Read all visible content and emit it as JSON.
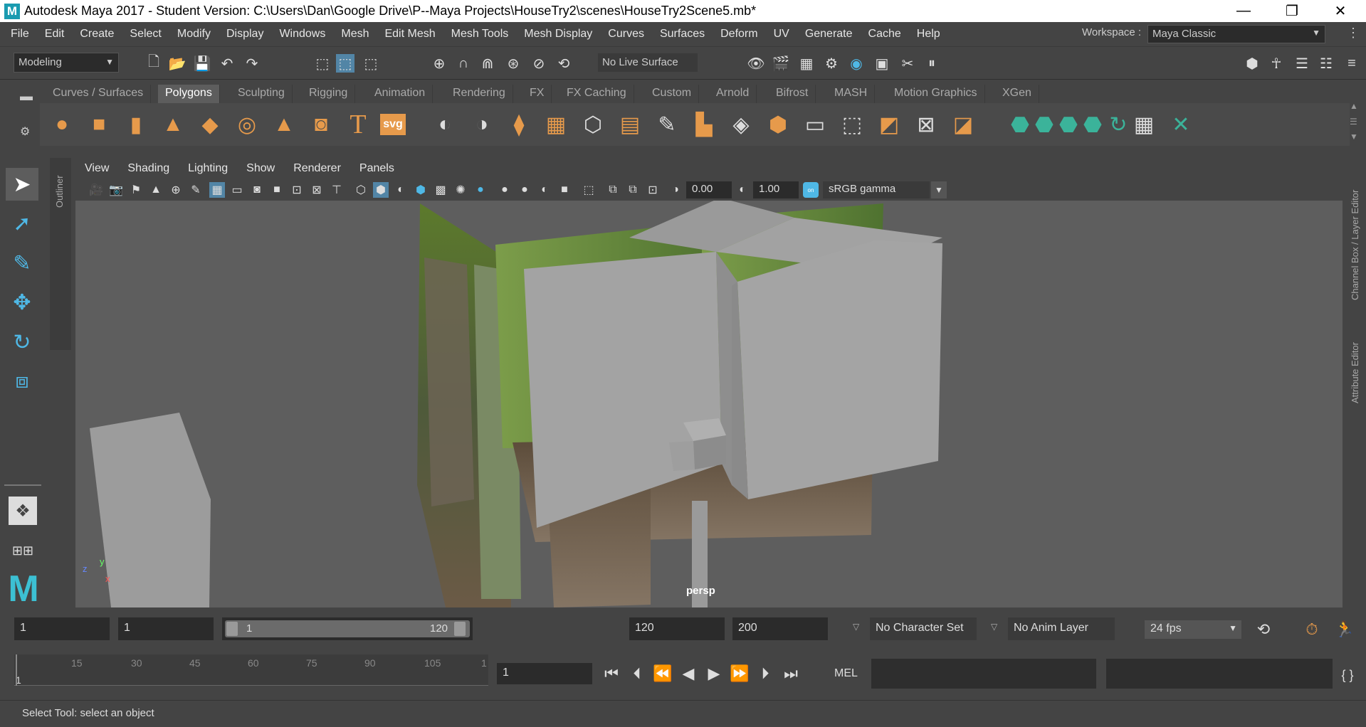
{
  "window": {
    "title": "Autodesk Maya 2017 - Student Version: C:\\Users\\Dan\\Google Drive\\P--Maya Projects\\HouseTry2\\scenes\\HouseTry2Scene5.mb*",
    "logo_letter": "M",
    "min": "—",
    "max": "❐",
    "close": "✕"
  },
  "menu": [
    "File",
    "Edit",
    "Create",
    "Select",
    "Modify",
    "Display",
    "Windows",
    "Mesh",
    "Edit Mesh",
    "Mesh Tools",
    "Mesh Display",
    "Curves",
    "Surfaces",
    "Deform",
    "UV",
    "Generate",
    "Cache",
    "Help"
  ],
  "workspace": {
    "label": "Workspace :",
    "value": "Maya Classic"
  },
  "status": {
    "menuset": "Modeling",
    "live_surface": "No Live Surface"
  },
  "shelf_tabs": [
    "Curves / Surfaces",
    "Polygons",
    "Sculpting",
    "Rigging",
    "Animation",
    "Rendering",
    "FX",
    "FX Caching",
    "Custom",
    "Arnold",
    "Bifrost",
    "MASH",
    "Motion Graphics",
    "XGen"
  ],
  "shelf_active": "Polygons",
  "shelf_text_icons": {
    "text": "T",
    "svg": "svg"
  },
  "side_labels": {
    "outliner": "Outliner",
    "channel_box": "Channel Box / Layer Editor",
    "attribute_editor": "Attribute Editor"
  },
  "panel_menu": [
    "View",
    "Shading",
    "Lighting",
    "Show",
    "Renderer",
    "Panels"
  ],
  "panel_toolbar": {
    "exposure": "0.00",
    "gamma": "1.00",
    "color_space": "sRGB gamma",
    "cm_badge": "on"
  },
  "viewport": {
    "camera_label": "persp",
    "axis_x": "x",
    "axis_y": "y",
    "axis_z": "z"
  },
  "timeline": {
    "ticks": [
      "1",
      "15",
      "30",
      "45",
      "60",
      "75",
      "90",
      "105",
      "1"
    ],
    "current_frame": "1",
    "range_start": "1",
    "playback_start": "1",
    "slider_start": "1",
    "slider_end": "120",
    "playback_end": "120",
    "range_end": "200",
    "character_set": "No Character Set",
    "anim_layer": "No Anim Layer",
    "fps": "24 fps"
  },
  "command": {
    "mode": "MEL"
  },
  "help_line": "Select Tool: select an object",
  "colors": {
    "accent": "#4fb8e6",
    "shelf_orange": "#e69a4b",
    "shelf_green": "#3bb39a",
    "panel_bg": "#444444",
    "viewport_bg": "#5e5e5e"
  }
}
